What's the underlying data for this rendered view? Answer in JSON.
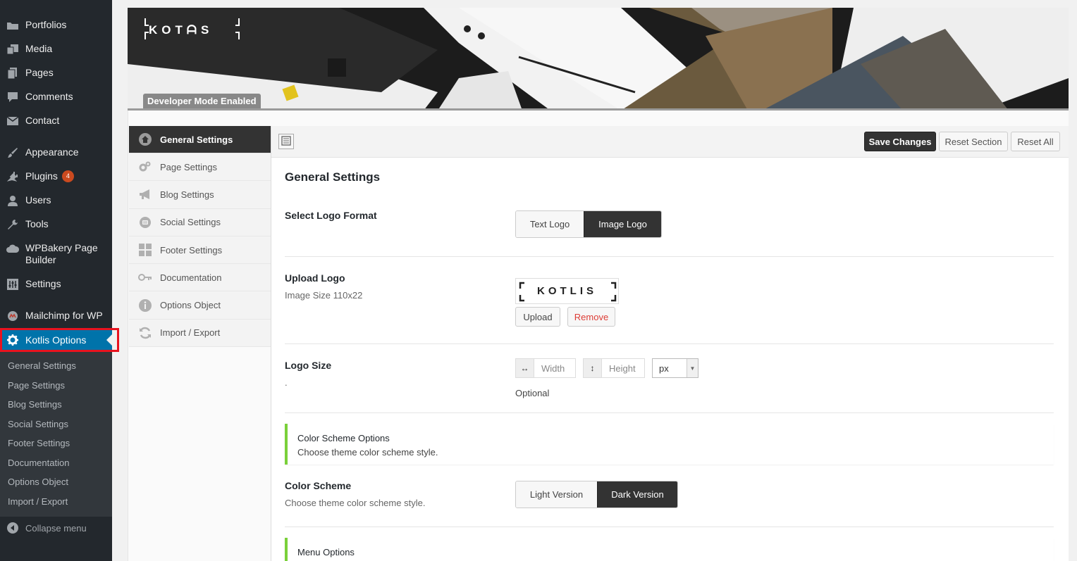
{
  "colors": {
    "wp_sidebar": "#23282d",
    "wp_active": "#0073aa",
    "highlight_outline": "#e8131f",
    "plugin_badge": "#ca4a1f",
    "panel_dark": "#333333",
    "info_accent": "#7ad03a",
    "remove_text": "#dd3d36"
  },
  "sidebar": {
    "items": [
      {
        "label": "Portfolios",
        "icon": "portfolio-icon"
      },
      {
        "label": "Media",
        "icon": "media-icon"
      },
      {
        "label": "Pages",
        "icon": "pages-icon"
      },
      {
        "label": "Comments",
        "icon": "comments-icon"
      },
      {
        "label": "Contact",
        "icon": "mail-icon"
      },
      {
        "label": "Appearance",
        "icon": "brush-icon"
      },
      {
        "label": "Plugins",
        "icon": "plugin-icon",
        "badge": "4"
      },
      {
        "label": "Users",
        "icon": "users-icon"
      },
      {
        "label": "Tools",
        "icon": "wrench-icon"
      },
      {
        "label": "WPBakery Page Builder",
        "icon": "cloud-icon"
      },
      {
        "label": "Settings",
        "icon": "settings-sliders-icon"
      },
      {
        "label": "Mailchimp for WP",
        "icon": "mailchimp-icon"
      },
      {
        "label": "Kotlis Options",
        "icon": "gear-icon"
      }
    ],
    "submenu": [
      "General Settings",
      "Page Settings",
      "Blog Settings",
      "Social Settings",
      "Footer Settings",
      "Documentation",
      "Options Object",
      "Import / Export"
    ],
    "collapse_label": "Collapse menu"
  },
  "banner": {
    "logo_text": "KOTᗩS",
    "dev_badge": "Developer Mode Enabled"
  },
  "options_nav": [
    {
      "label": "General Settings",
      "icon": "home-icon"
    },
    {
      "label": "Page Settings",
      "icon": "cogs-icon"
    },
    {
      "label": "Blog Settings",
      "icon": "megaphone-icon"
    },
    {
      "label": "Social Settings",
      "icon": "social-icon"
    },
    {
      "label": "Footer Settings",
      "icon": "grid-icon"
    },
    {
      "label": "Documentation",
      "icon": "key-icon"
    },
    {
      "label": "Options Object",
      "icon": "info-icon"
    },
    {
      "label": "Import / Export",
      "icon": "refresh-icon"
    }
  ],
  "toolbar": {
    "save": "Save Changes",
    "reset_section": "Reset Section",
    "reset_all": "Reset All"
  },
  "main": {
    "section_title": "General Settings",
    "logo_format": {
      "title": "Select Logo Format",
      "options": [
        "Text Logo",
        "Image Logo"
      ],
      "selected": "Image Logo"
    },
    "upload_logo": {
      "title": "Upload Logo",
      "desc": "Image Size 110x22",
      "preview_text": "KOTLIS",
      "upload": "Upload",
      "remove": "Remove"
    },
    "logo_size": {
      "title": "Logo Size",
      "desc": ".",
      "width_placeholder": "Width",
      "height_placeholder": "Height",
      "unit": "px",
      "note": "Optional"
    },
    "color_scheme_info": {
      "title": "Color Scheme Options",
      "desc": "Choose theme color scheme style."
    },
    "color_scheme": {
      "title": "Color Scheme",
      "desc": "Choose theme color scheme style.",
      "options": [
        "Light Version",
        "Dark Version"
      ],
      "selected": "Dark Version"
    },
    "menu_info": {
      "title": "Menu Options"
    }
  }
}
